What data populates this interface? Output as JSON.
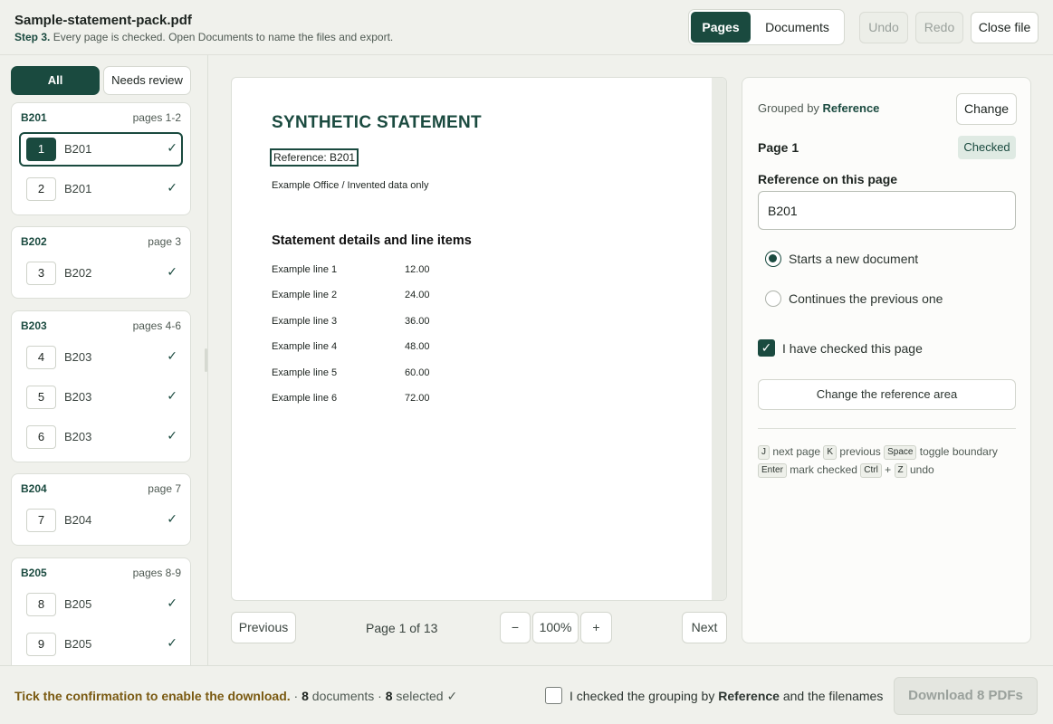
{
  "header": {
    "filename": "Sample-statement-pack.pdf",
    "step_label": "Step 3.",
    "step_text": " Every page is checked. Open Documents to name the files and export.",
    "tab_pages": "Pages",
    "tab_documents": "Documents",
    "undo": "Undo",
    "redo": "Redo",
    "close_file": "Close file"
  },
  "sidebar": {
    "filter_all": "All",
    "filter_review": "Needs review",
    "groups": [
      {
        "id": "B201",
        "pages": "pages 1-2",
        "rows": [
          {
            "num": "1",
            "ref": "B201",
            "check": "✓"
          },
          {
            "num": "2",
            "ref": "B201",
            "check": "✓"
          }
        ]
      },
      {
        "id": "B202",
        "pages": "page 3",
        "rows": [
          {
            "num": "3",
            "ref": "B202",
            "check": "✓"
          }
        ]
      },
      {
        "id": "B203",
        "pages": "pages 4-6",
        "rows": [
          {
            "num": "4",
            "ref": "B203",
            "check": "✓"
          },
          {
            "num": "5",
            "ref": "B203",
            "check": "✓"
          },
          {
            "num": "6",
            "ref": "B203",
            "check": "✓"
          }
        ]
      },
      {
        "id": "B204",
        "pages": "page 7",
        "rows": [
          {
            "num": "7",
            "ref": "B204",
            "check": "✓"
          }
        ]
      },
      {
        "id": "B205",
        "pages": "pages 8-9",
        "rows": [
          {
            "num": "8",
            "ref": "B205",
            "check": "✓"
          },
          {
            "num": "9",
            "ref": "B205",
            "check": "✓"
          }
        ]
      }
    ]
  },
  "document": {
    "title": "SYNTHETIC STATEMENT",
    "reference": "Reference: B201",
    "office": "Example Office / Invented data only",
    "section": "Statement details and line items",
    "lines": [
      {
        "label": "Example line 1",
        "value": "12.00"
      },
      {
        "label": "Example line 2",
        "value": "24.00"
      },
      {
        "label": "Example line 3",
        "value": "36.00"
      },
      {
        "label": "Example line 4",
        "value": "48.00"
      },
      {
        "label": "Example line 5",
        "value": "60.00"
      },
      {
        "label": "Example line 6",
        "value": "72.00"
      }
    ]
  },
  "pager": {
    "previous": "Previous",
    "page_info": "Page 1 of 13",
    "zoom_out": "−",
    "zoom": "100%",
    "zoom_in": "+",
    "next": "Next"
  },
  "panel": {
    "grouped_prefix": "Grouped by ",
    "grouped_field": "Reference",
    "change": "Change",
    "page_title": "Page 1",
    "status": "Checked",
    "ref_label": "Reference on this page",
    "ref_value": "B201",
    "radio_new": "Starts a new document",
    "radio_continue": "Continues the previous one",
    "checked_label": "I have checked this page",
    "area_button": "Change the reference area",
    "shortcuts": {
      "k_j": "J",
      "t_next": " next page ",
      "k_k": "K",
      "t_prev": " previous ",
      "k_space": "Space",
      "t_toggle": " toggle boundary",
      "k_enter": "Enter",
      "t_mark": " mark checked ",
      "k_ctrl": "Ctrl",
      "t_plus": " + ",
      "k_z": "Z",
      "t_undo": " undo"
    }
  },
  "footer": {
    "warning": "Tick the confirmation to enable the download.",
    "sep1": " · ",
    "docs_count": "8",
    "docs_text": " documents · ",
    "selected_count": "8",
    "selected_text": " selected ✓",
    "confirm_pre": "I checked the grouping by ",
    "confirm_field": "Reference",
    "confirm_post": " and the filenames",
    "download": "Download 8 PDFs"
  },
  "colors": {
    "accent": "#1a4a3f",
    "warning": "#7a5a12",
    "badge_bg": "#dfeae3"
  }
}
